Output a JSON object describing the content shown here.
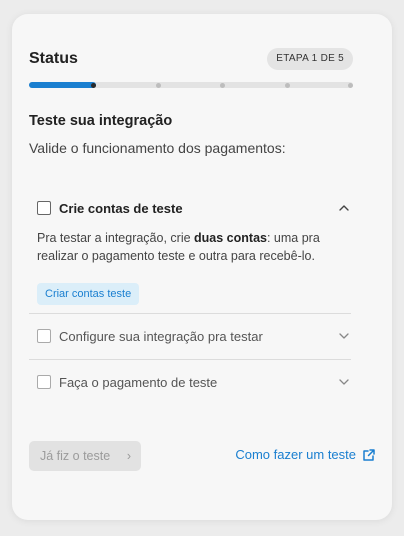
{
  "status": {
    "title": "Status",
    "step_badge": "ETAPA 1 DE 5",
    "progress": 0.2,
    "steps_total": 5,
    "current_step": 1
  },
  "section": {
    "title": "Teste sua integração",
    "subtitle": "Valide o funcionamento dos pagamentos:"
  },
  "items": [
    {
      "label": "Crie contas de teste",
      "expanded": true,
      "body_pre": "Pra testar a integração, crie ",
      "body_bold": "duas contas",
      "body_post": ": uma pra realizar o pagamento teste e outra para recebê-lo.",
      "button": "Criar contas teste"
    },
    {
      "label": "Configure sua integração pra testar",
      "expanded": false
    },
    {
      "label": "Faça o pagamento de teste",
      "expanded": false
    }
  ],
  "footer": {
    "done_button": "Já fiz o teste",
    "help_link": "Como fazer um teste"
  },
  "colors": {
    "accent": "#1a7fd0",
    "button_bg": "#dbeef9"
  },
  "icons": {
    "chevron_up": "chevron-up-icon",
    "chevron_down": "chevron-down-icon",
    "external_link": "external-link-icon"
  }
}
